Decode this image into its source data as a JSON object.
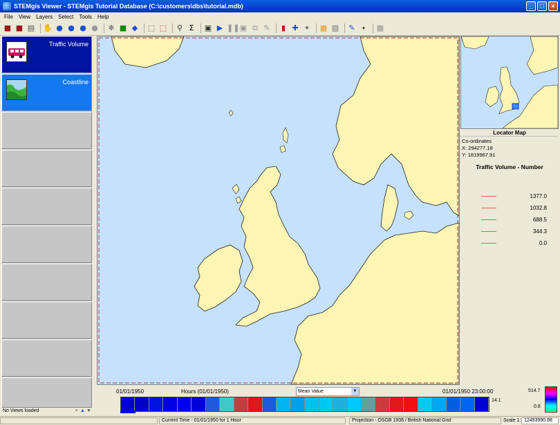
{
  "window": {
    "title": "STEMgis Viewer - STEMgis Tutorial Database (C:\\customers\\dbs\\tutorial.mdb)",
    "minimize_glyph": "_",
    "maximize_glyph": "□",
    "close_glyph": "×"
  },
  "menu": [
    "File",
    "View",
    "Layers",
    "Select",
    "Tools",
    "Help"
  ],
  "toolbar": {
    "icons": [
      "open-icon",
      "save-icon",
      "print-icon",
      "pan-icon",
      "zoom-in-icon",
      "zoom-out-icon",
      "zoom-full-icon",
      "zoom-layer-icon",
      "locate-icon",
      "flag-icon",
      "identify-icon",
      "select-icon",
      "clear-selection-icon",
      "query-icon",
      "sum-icon",
      "camera-icon",
      "play-icon",
      "pause-icon",
      "video-icon",
      "stack-icon",
      "pen-icon",
      "chart-icon",
      "grid-icon",
      "export-icon",
      "draw-icon",
      "lock-icon"
    ],
    "sum_glyph": "Σ"
  },
  "layers": [
    {
      "label": "Traffic Volume",
      "kind": "traffic"
    },
    {
      "label": "Coastline",
      "kind": "coast"
    }
  ],
  "sidebar_footer": {
    "status": "No Views loaded",
    "close_glyph": "×",
    "up_glyph": "▲",
    "down_glyph": "▼"
  },
  "locator": {
    "title": "Locator Map",
    "coords_label": "Co-ordinates",
    "x": "X: 294277.18",
    "y": "Y: 1819967.91"
  },
  "legend": {
    "title": "Traffic Volume - Number",
    "values": [
      "1377.0",
      "1032.8",
      "688.5",
      "344.3",
      "0.0"
    ]
  },
  "timeline": {
    "start": "01/01/1950",
    "hours_label": "Hours (01/01/1950)",
    "mode": "Mean Value",
    "mode_arrow": "▼",
    "end": "01/01/1950 23:00:00",
    "scale_max": "514.7",
    "scale_mid": "14.1",
    "scale_min": "0.8",
    "cells": [
      "#0000d0",
      "#0000c8",
      "#0014e0",
      "#0000e0",
      "#0000f0",
      "#0000d8",
      "#1e5ad8",
      "#40c8c8",
      "#c04040",
      "#e01818",
      "#1e5ad8",
      "#00b4f0",
      "#00a0e8",
      "#00c0f0",
      "#00c8f0",
      "#20b0e0",
      "#00c8f8",
      "#60a0a0",
      "#c83c3c",
      "#e01818",
      "#f01010",
      "#00c8f8",
      "#00a8f0",
      "#0060e0",
      "#0064f0",
      "#0000d0"
    ]
  },
  "status": {
    "current_time": "Current Time - 01/01/1950 for 1 Hour",
    "projection": "Projection - OSGB 1936 / British National Grid",
    "scale_label": "Scale 1:",
    "scale_value": "12493990.88"
  },
  "colors": {
    "land": "#fcf5b4",
    "sea": "#c6e1fc",
    "traffic_tile": "#0014a0",
    "coast_tile": "#1478f0"
  }
}
